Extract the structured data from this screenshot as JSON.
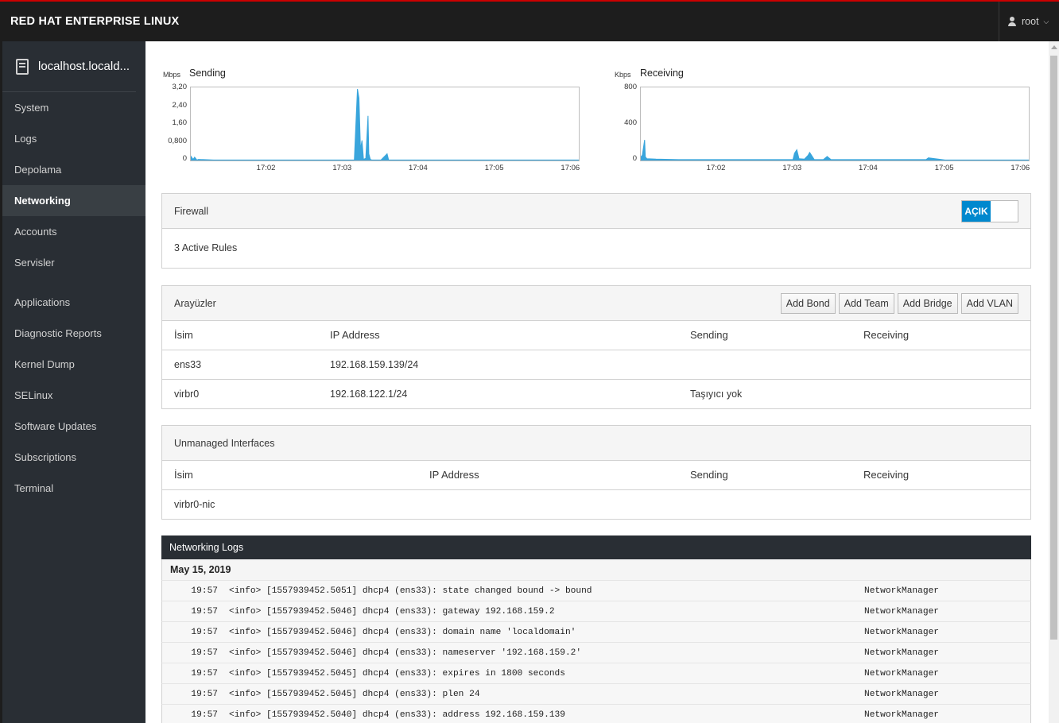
{
  "header": {
    "brand": "RED HAT ENTERPRISE LINUX",
    "user": "root"
  },
  "sidebar": {
    "host": "localhost.locald...",
    "items": [
      {
        "label": "System"
      },
      {
        "label": "Logs"
      },
      {
        "label": "Depolama"
      },
      {
        "label": "Networking",
        "active": true
      },
      {
        "label": "Accounts"
      },
      {
        "label": "Servisler"
      }
    ],
    "items2": [
      {
        "label": "Applications"
      },
      {
        "label": "Diagnostic Reports"
      },
      {
        "label": "Kernel Dump"
      },
      {
        "label": "SELinux"
      },
      {
        "label": "Software Updates"
      },
      {
        "label": "Subscriptions"
      },
      {
        "label": "Terminal"
      }
    ]
  },
  "chart_data": [
    {
      "type": "area",
      "title": "Sending",
      "unit": "Mbps",
      "yticks": [
        "3,20",
        "2,40",
        "1,60",
        "0,800",
        "0"
      ],
      "ylim": [
        0,
        3.2
      ],
      "xticks": [
        "17:02",
        "17:03",
        "17:04",
        "17:05",
        "17:06"
      ],
      "xlim": [
        1.0,
        6.1
      ],
      "color": "#39a5dc",
      "x": [
        1.0,
        1.03,
        1.05,
        1.08,
        1.1,
        1.3,
        2.0,
        3.15,
        3.17,
        3.19,
        3.21,
        3.23,
        3.25,
        3.27,
        3.3,
        3.33,
        3.34,
        3.36,
        3.38,
        3.5,
        3.58,
        3.6,
        3.62,
        4.0,
        5.0,
        6.1
      ],
      "y": [
        0.2,
        0.05,
        0.15,
        0.02,
        0.05,
        0.02,
        0.02,
        0.03,
        1.6,
        3.2,
        2.8,
        0.5,
        0.9,
        0.05,
        0.1,
        2.0,
        0.3,
        0.05,
        0.02,
        0.02,
        0.3,
        0.02,
        0.02,
        0.02,
        0.02,
        0.02
      ]
    },
    {
      "type": "area",
      "title": "Receiving",
      "unit": "Kbps",
      "yticks": [
        "800",
        "400",
        "0"
      ],
      "ylim": [
        0,
        800
      ],
      "xticks": [
        "17:02",
        "17:03",
        "17:04",
        "17:05",
        "17:06"
      ],
      "xlim": [
        1.0,
        6.1
      ],
      "color": "#39a5dc",
      "x": [
        1.0,
        1.02,
        1.05,
        1.06,
        1.08,
        1.2,
        1.5,
        2.0,
        3.0,
        3.02,
        3.05,
        3.08,
        3.15,
        3.2,
        3.22,
        3.28,
        3.4,
        3.45,
        3.5,
        4.0,
        4.5,
        4.75,
        4.78,
        5.0,
        6.1
      ],
      "y": [
        40,
        60,
        230,
        40,
        20,
        15,
        10,
        10,
        10,
        80,
        120,
        20,
        15,
        60,
        90,
        10,
        10,
        45,
        10,
        10,
        10,
        10,
        30,
        5,
        5
      ]
    }
  ],
  "firewall": {
    "title": "Firewall",
    "toggle": "AÇIK",
    "rules": "3 Active Rules"
  },
  "interfaces": {
    "title": "Arayüzler",
    "buttons": [
      "Add Bond",
      "Add Team",
      "Add Bridge",
      "Add VLAN"
    ],
    "columns": [
      "İsim",
      "IP Address",
      "Sending",
      "Receiving"
    ],
    "rows": [
      [
        "ens33",
        "192.168.159.139/24",
        "",
        ""
      ],
      [
        "virbr0",
        "192.168.122.1/24",
        "Taşıyıcı yok",
        ""
      ]
    ]
  },
  "unmanaged": {
    "title": "Unmanaged Interfaces",
    "columns": [
      "İsim",
      "IP Address",
      "Sending",
      "Receiving"
    ],
    "rows": [
      [
        "virbr0-nic",
        "",
        "",
        ""
      ]
    ]
  },
  "logs": {
    "title": "Networking Logs",
    "date": "May 15, 2019",
    "entries": [
      {
        "time": "19:57",
        "msg": "<info> [1557939452.5051] dhcp4 (ens33): state changed bound -> bound",
        "src": "NetworkManager"
      },
      {
        "time": "19:57",
        "msg": "<info> [1557939452.5046] dhcp4 (ens33): gateway 192.168.159.2",
        "src": "NetworkManager"
      },
      {
        "time": "19:57",
        "msg": "<info> [1557939452.5046] dhcp4 (ens33): domain name 'localdomain'",
        "src": "NetworkManager"
      },
      {
        "time": "19:57",
        "msg": "<info> [1557939452.5046] dhcp4 (ens33): nameserver '192.168.159.2'",
        "src": "NetworkManager"
      },
      {
        "time": "19:57",
        "msg": "<info> [1557939452.5045] dhcp4 (ens33): expires in 1800 seconds",
        "src": "NetworkManager"
      },
      {
        "time": "19:57",
        "msg": "<info> [1557939452.5045] dhcp4 (ens33): plen 24",
        "src": "NetworkManager"
      },
      {
        "time": "19:57",
        "msg": "<info> [1557939452.5040] dhcp4 (ens33): address 192.168.159.139",
        "src": "NetworkManager"
      }
    ]
  }
}
